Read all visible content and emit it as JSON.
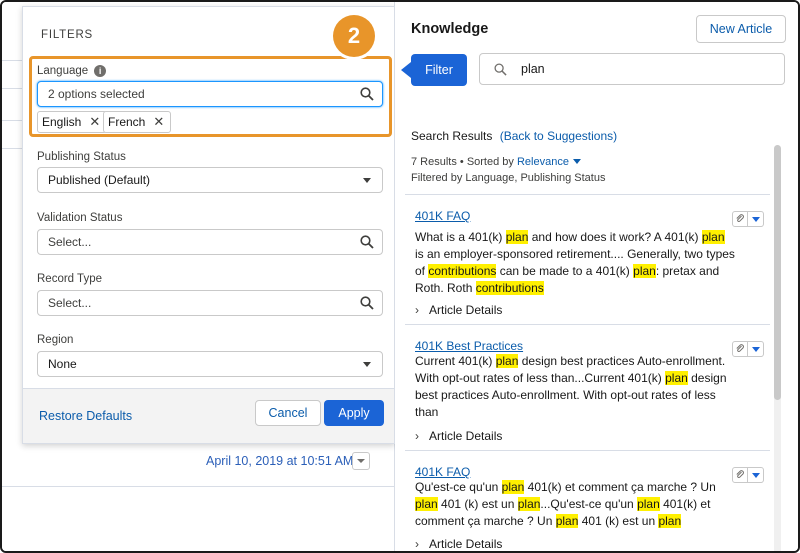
{
  "filters": {
    "title": "FILTERS",
    "language_label": "Language",
    "language_value": "2 options selected",
    "language_pills": [
      "English",
      "French"
    ],
    "publishing_label": "Publishing Status",
    "publishing_value": "Published (Default)",
    "validation_label": "Validation Status",
    "validation_placeholder": "Select...",
    "record_type_label": "Record Type",
    "record_type_placeholder": "Select...",
    "region_label": "Region",
    "region_value": "None",
    "restore_label": "Restore Defaults",
    "cancel_label": "Cancel",
    "apply_label": "Apply",
    "step_number": "2"
  },
  "background": {
    "date_text": "April 10, 2019 at 10:51 AM"
  },
  "knowledge": {
    "title": "Knowledge",
    "new_article_label": "New Article",
    "filter_label": "Filter",
    "search_value": "plan",
    "results_label": "Search Results",
    "back_link": "(Back to Suggestions)",
    "count_text": "7 Results • Sorted by",
    "sort_value": "Relevance",
    "filtered_by": "Filtered by Language, Publishing Status",
    "details_label": "Article Details",
    "results": [
      {
        "title": "401K FAQ",
        "body": [
          {
            "t": "What is a 401(k) "
          },
          {
            "t": "plan",
            "h": true
          },
          {
            "t": " and how does it work? A 401(k) "
          },
          {
            "t": "plan",
            "h": true
          },
          {
            "t": " is an employer-sponsored retirement.... Generally, two types of "
          },
          {
            "t": "contributions",
            "h": true
          },
          {
            "t": " can be made to a 401(k) "
          },
          {
            "t": "plan",
            "h": true
          },
          {
            "t": ": pretax and Roth. Roth "
          },
          {
            "t": "contributions",
            "h": true
          }
        ]
      },
      {
        "title": "401K Best Practices",
        "body": [
          {
            "t": "Current 401(k) "
          },
          {
            "t": "plan",
            "h": true
          },
          {
            "t": " design best practices Auto-enrollment. With opt-out rates of less than...Current 401(k) "
          },
          {
            "t": "plan",
            "h": true
          },
          {
            "t": " design best practices Auto-enrollment. With opt-out rates of less than"
          }
        ]
      },
      {
        "title": "401K FAQ",
        "body": [
          {
            "t": "Qu'est-ce qu'un "
          },
          {
            "t": "plan",
            "h": true
          },
          {
            "t": " 401(k) et comment ça marche ? Un "
          },
          {
            "t": "plan",
            "h": true
          },
          {
            "t": " 401 (k) est un "
          },
          {
            "t": "plan",
            "h": true
          },
          {
            "t": "...Qu'est-ce qu'un "
          },
          {
            "t": "plan",
            "h": true
          },
          {
            "t": " 401(k) et comment ça marche ? Un "
          },
          {
            "t": "plan",
            "h": true
          },
          {
            "t": " 401 (k) est un "
          },
          {
            "t": "plan",
            "h": true
          }
        ]
      }
    ]
  },
  "colors": {
    "brand_blue": "#1b64d6",
    "callout_orange": "#e8952a",
    "highlight_yellow": "#fff000"
  }
}
